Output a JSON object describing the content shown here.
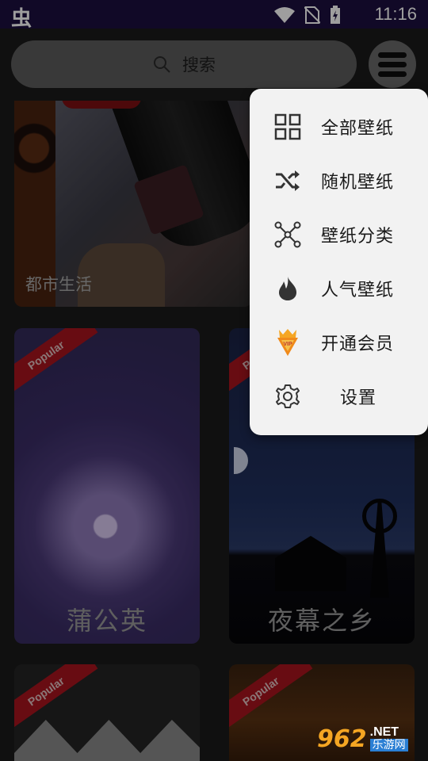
{
  "status_bar": {
    "app_glyph": "虫",
    "time": "11:16"
  },
  "search": {
    "placeholder": "搜索"
  },
  "cards": {
    "top": {
      "title": "都市生活"
    },
    "dandelion": {
      "title": "蒲公英",
      "badge": "Popular"
    },
    "night": {
      "title": "夜幕之乡",
      "badge": "Popular"
    },
    "zigzag": {
      "badge": "Popular"
    },
    "autumn": {
      "badge": "Popular"
    }
  },
  "menu": {
    "items": [
      {
        "label": "全部壁纸",
        "icon": "grid-icon"
      },
      {
        "label": "随机壁纸",
        "icon": "shuffle-icon"
      },
      {
        "label": "壁纸分类",
        "icon": "category-icon"
      },
      {
        "label": "人气壁纸",
        "icon": "flame-icon"
      },
      {
        "label": "开通会员",
        "icon": "vip-crown-icon"
      },
      {
        "label": "设置",
        "icon": "gear-icon"
      }
    ]
  },
  "watermark": {
    "number": "962",
    "net": ".NET",
    "site": "乐游网"
  },
  "colors": {
    "status_bar": "#1c1040",
    "menu_bg": "#f2f2f2",
    "ribbon": "#a8141e",
    "vip_orange": "#f5a623"
  }
}
